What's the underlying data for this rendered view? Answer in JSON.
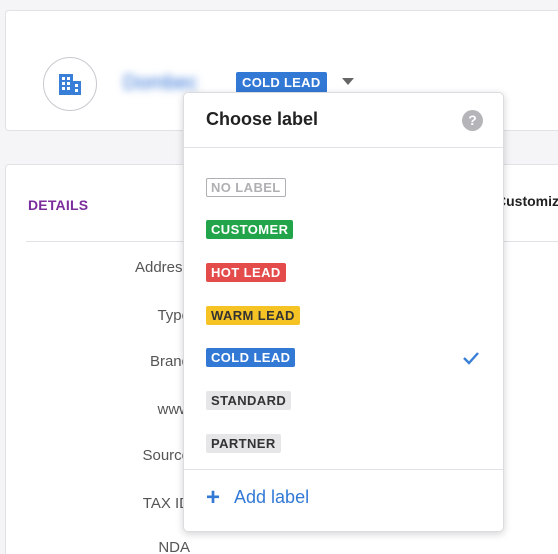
{
  "header": {
    "org_name": "Dombec",
    "badge": "COLD LEAD",
    "caret_icon": "chevron-down-icon",
    "avatar_icon": "building-icon"
  },
  "details": {
    "title": "DETAILS",
    "customize_label": "Customize",
    "fields": [
      "Address",
      "Type",
      "Brand",
      "www",
      "Source",
      "TAX ID",
      "NDA"
    ]
  },
  "dropdown": {
    "title": "Choose label",
    "help_icon": "?",
    "labels": [
      {
        "text": "NO LABEL",
        "style": "none"
      },
      {
        "text": "CUSTOMER",
        "style": "customer"
      },
      {
        "text": "HOT LEAD",
        "style": "hot"
      },
      {
        "text": "WARM LEAD",
        "style": "warm"
      },
      {
        "text": "COLD LEAD",
        "style": "cold",
        "selected": true
      },
      {
        "text": "STANDARD",
        "style": "standard"
      },
      {
        "text": "PARTNER",
        "style": "partner"
      }
    ],
    "add_label": "Add label",
    "plus_icon": "+"
  },
  "colors": {
    "accent_blue": "#3279d6",
    "details_purple": "#7b2d9e",
    "customer_green": "#22a54a",
    "hot_red": "#e44b4b",
    "warm_yellow": "#f6c324"
  }
}
